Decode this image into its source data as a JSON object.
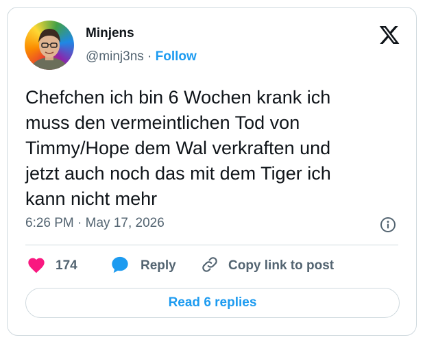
{
  "author": {
    "display_name": "Minjens",
    "handle": "@minj3ns",
    "separator": "·",
    "follow_label": "Follow"
  },
  "tweet": {
    "text": "Chefchen ich bin 6 Wochen krank ich\nmuss den vermeintlichen Tod von\nTimmy/Hope dem Wal verkraften und\njetzt auch noch das mit dem Tiger ich\nkann nicht mehr",
    "timestamp": "6:26 PM · May 17, 2026"
  },
  "actions": {
    "like_count": "174",
    "reply_label": "Reply",
    "copy_label": "Copy link to post"
  },
  "read_replies_label": "Read 6 replies",
  "icons": {
    "brand": "x-logo-icon",
    "info": "info-icon",
    "like": "heart-icon",
    "reply": "speech-bubble-icon",
    "copy": "link-icon"
  },
  "colors": {
    "accent": "#1d9bf0",
    "like": "#f91880",
    "text": "#0f1419",
    "secondary": "#536471",
    "border": "#cfd9de"
  }
}
